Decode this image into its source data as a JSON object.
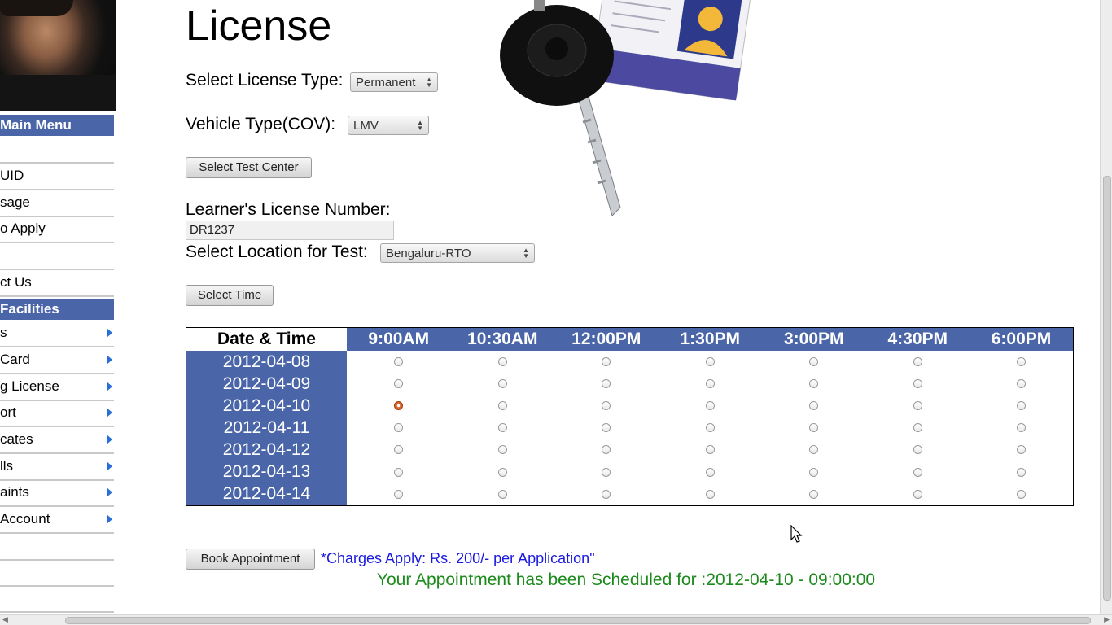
{
  "sidebar": {
    "menu_header": "Main Menu",
    "menu_items": [
      "UID",
      "sage",
      "o Apply",
      "",
      "ct Us"
    ],
    "facilities_header": " Facilities",
    "facility_items": [
      "s",
      "Card",
      "g License",
      "ort",
      "cates",
      "lls",
      "aints",
      " Account"
    ]
  },
  "page": {
    "title": "License",
    "license_type_label": "Select License Type:",
    "license_type_value": "Permanent",
    "vehicle_type_label": "Vehicle Type(COV):",
    "vehicle_type_value": "LMV",
    "select_test_center_button": "Select Test Center",
    "learner_license_label": "Learner's License Number:",
    "learner_license_value": "DR1237",
    "location_label": "Select Location for Test:",
    "location_value": "Bengaluru-RTO",
    "select_time_button": "Select Time",
    "book_button": "Book Appointment",
    "charges_text": "*Charges Apply: Rs. 200/- per Application\"",
    "confirmation_text": "Your Appointment has been Scheduled for :2012-04-10 - 09:00:00"
  },
  "schedule": {
    "corner_header": "Date & Time",
    "times": [
      "9:00AM",
      "10:30AM",
      "12:00PM",
      "1:30PM",
      "3:00PM",
      "4:30PM",
      "6:00PM"
    ],
    "dates": [
      "2012-04-08",
      "2012-04-09",
      "2012-04-10",
      "2012-04-11",
      "2012-04-12",
      "2012-04-13",
      "2012-04-14"
    ],
    "selected": {
      "date": "2012-04-10",
      "time": "9:00AM"
    }
  },
  "colors": {
    "header_blue": "#4a66a8",
    "charges_blue": "#1a1adf",
    "confirm_green": "#1c8a1c"
  }
}
